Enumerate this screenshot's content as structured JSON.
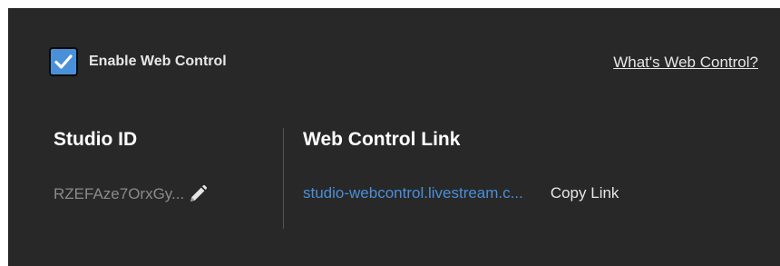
{
  "enable": {
    "label": "Enable Web Control",
    "checked": true,
    "check_icon": "checkmark-icon"
  },
  "help_link": "What's Web Control?",
  "studio": {
    "title": "Studio ID",
    "value": "RZEFAze7OrxGy...",
    "edit_icon": "pencil-icon"
  },
  "web_control": {
    "title": "Web Control Link",
    "link": "studio-webcontrol.livestream.c...",
    "copy_label": "Copy Link"
  },
  "colors": {
    "panel_bg": "#282828",
    "accent": "#4a90d9",
    "link": "#4a8fd8",
    "muted_text": "#8a8a8a"
  }
}
